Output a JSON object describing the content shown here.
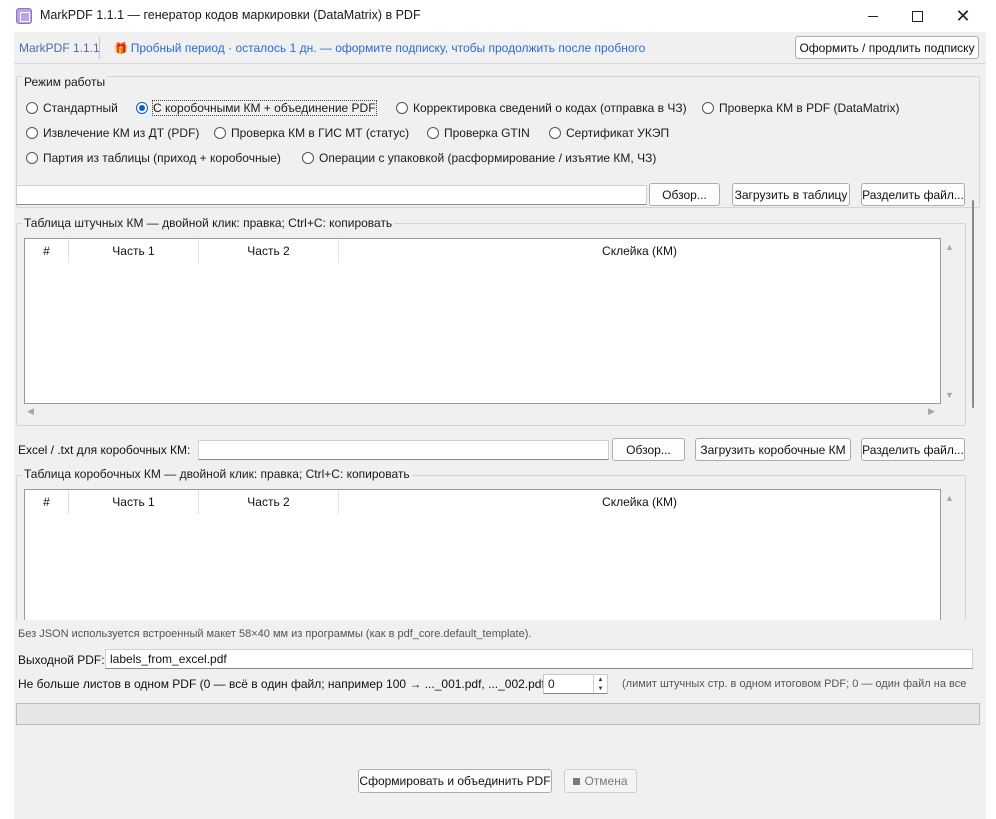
{
  "window": {
    "title": "MarkPDF 1.1.1 — генератор кодов маркировки (DataMatrix) в PDF",
    "close_glyph": "✕"
  },
  "header": {
    "version": "MarkPDF 1.1.1",
    "trial_icon": "gift-icon",
    "trial_text": "Пробный период · осталось 1 дн. — оформите подписку, чтобы продолжить после пробного",
    "subscribe_button": "Оформить / продлить подписку"
  },
  "mode": {
    "label": "Режим работы",
    "selected": "С коробочными КМ + объединение PDF",
    "options": [
      "Стандартный",
      "С коробочными КМ + объединение PDF",
      "Корректировка сведений о кодах (отправка в ЧЗ)",
      "Проверка КМ в PDF (DataMatrix)",
      "Извлечение КМ из ДТ (PDF)",
      "Проверка КМ в ГИС МТ (статус)",
      "Проверка GTIN",
      "Сертификат УКЭП",
      "Партия из таблицы (приход + коробочные)",
      "Операции с упаковкой (расформирование / изъятие КМ, ЧЗ)"
    ]
  },
  "file_row": {
    "path_value": "",
    "browse_button": "Обзор...",
    "load_button": "Загрузить в таблицу",
    "split_button": "Разделить файл..."
  },
  "unit_table": {
    "caption": "Таблица штучных КМ — двойной клик: правка; Ctrl+C: копировать",
    "columns": [
      "#",
      "Часть 1",
      "Часть 2",
      "Склейка (КМ)"
    ],
    "rows": []
  },
  "box_file_row": {
    "label": "Excel / .txt для коробочных КМ:",
    "path_value": "",
    "browse_button": "Обзор...",
    "load_button": "Загрузить коробочные КМ",
    "split_button": "Разделить файл..."
  },
  "box_table": {
    "caption": "Таблица коробочных КМ — двойной клик: правка; Ctrl+C: копировать",
    "columns": [
      "#",
      "Часть 1",
      "Часть 2",
      "Склейка (КМ)"
    ],
    "rows": []
  },
  "template_note": "Без JSON используется встроенный макет 58×40 мм из программы (как в pdf_core.default_template).",
  "output": {
    "label": "Выходной PDF:",
    "value": "labels_from_excel.pdf"
  },
  "max_pages": {
    "label": "Не больше листов в одном PDF (0 — всё в один файл; например 100 → ..._001.pdf, ..._002.pdf):",
    "value": "0",
    "hint": "(лимит штучных стр. в одном итоговом PDF; 0 — один файл на все"
  },
  "progress": {
    "fraction": 0
  },
  "actions": {
    "generate_button": "Сформировать и объединить PDF",
    "cancel_button": "Отмена"
  }
}
